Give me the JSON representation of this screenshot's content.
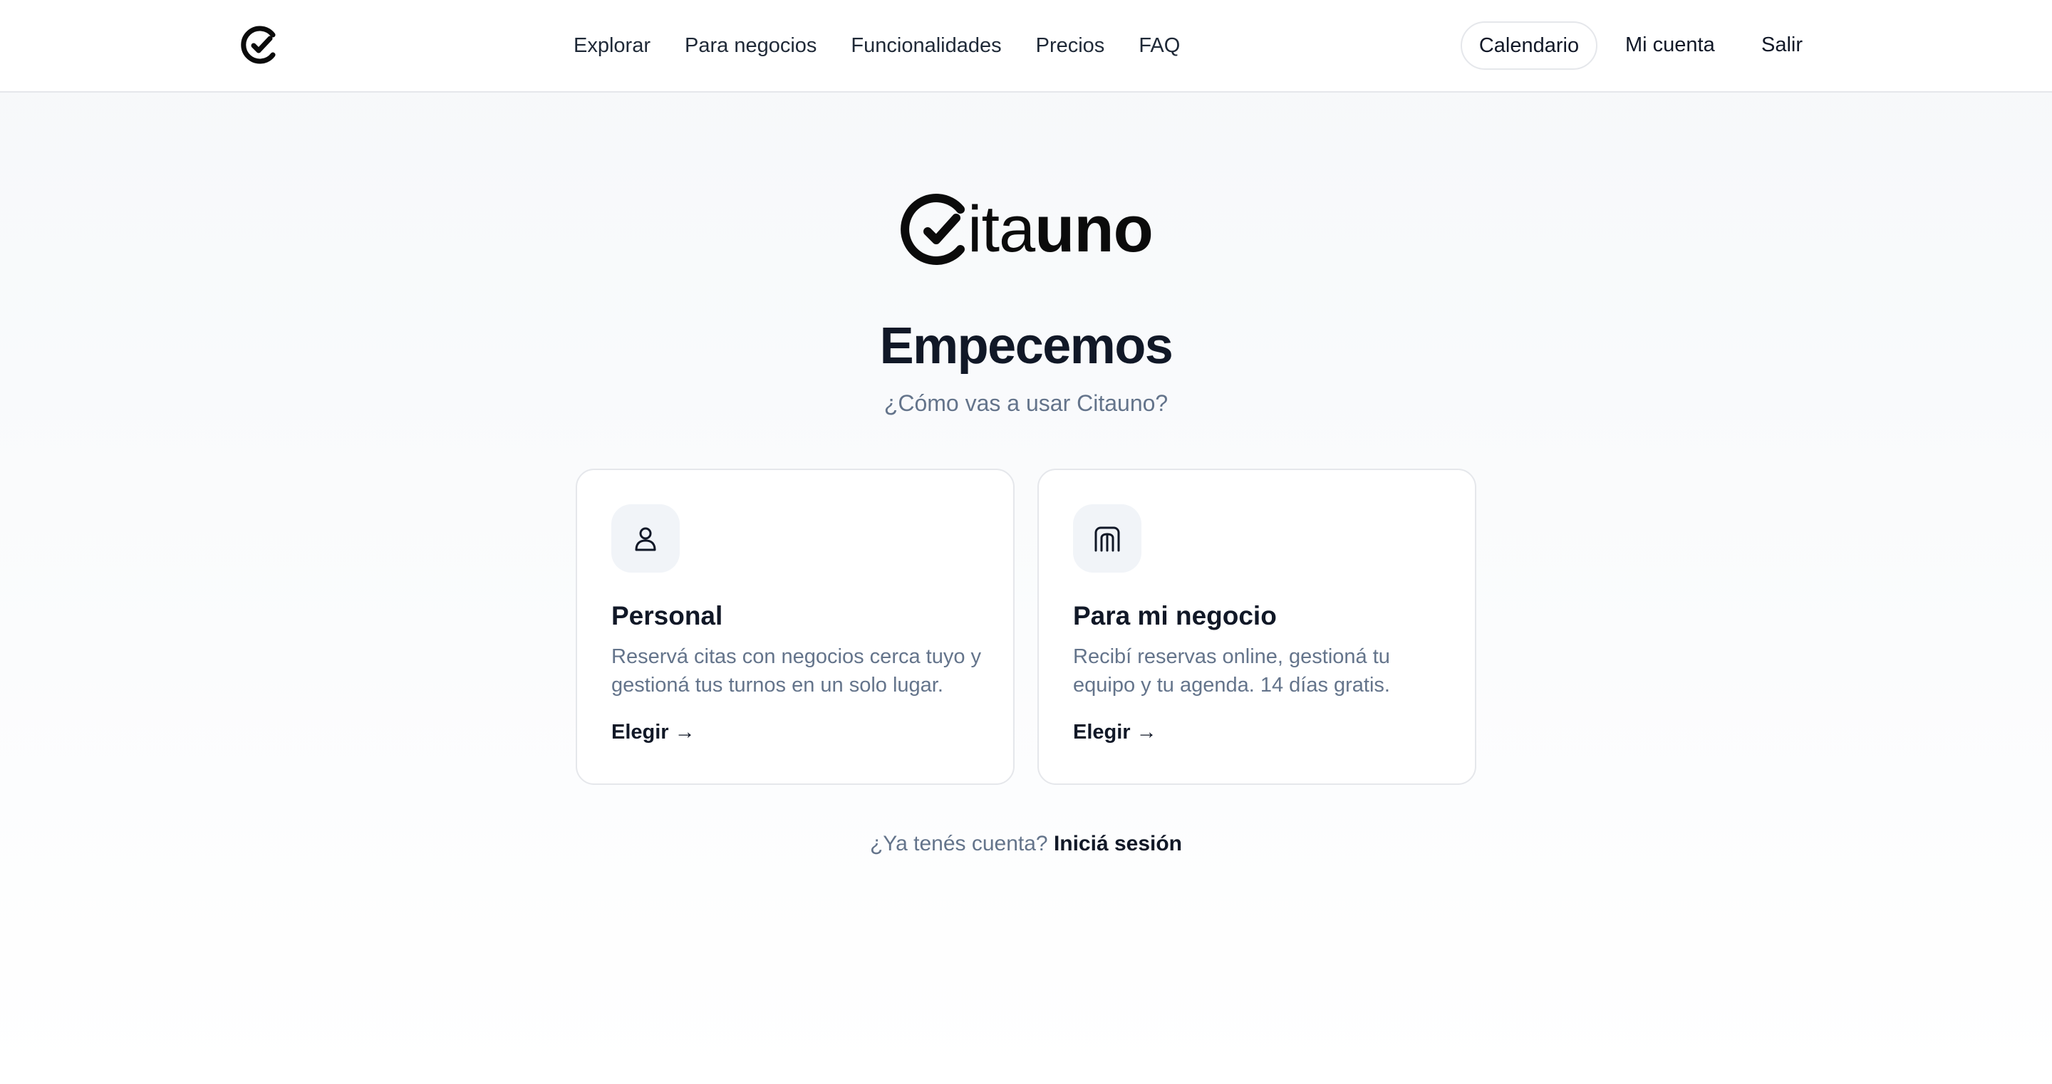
{
  "nav": {
    "logo_icon": "citauno-check-icon",
    "links": [
      "Explorar",
      "Para negocios",
      "Funcionalidades",
      "Precios",
      "FAQ"
    ],
    "calendar_button": "Calendario",
    "account": "Mi cuenta",
    "exit": "Salir"
  },
  "brand": {
    "name_light": "ita",
    "name_bold": "uno",
    "mark_icon": "citauno-logo-c-check-icon"
  },
  "heading": {
    "title": "Empecemos",
    "subtitle": "¿Cómo vas a usar Citauno?"
  },
  "cards": [
    {
      "icon": "user-icon",
      "title": "Personal",
      "description": "Reservá citas con negocios cerca tuyo y gestioná tus turnos en un solo lugar.",
      "cta": "Elegir →"
    },
    {
      "icon": "building-icon",
      "title": "Para mi negocio",
      "description": "Recibí reservas online, gestioná tu equipo y tu agenda. 14 días gratis.",
      "cta": "Elegir →"
    }
  ],
  "footer": {
    "question": "¿Ya tenés cuenta?",
    "login_link": "Iniciá sesión"
  },
  "colors": {
    "text_primary": "#111827",
    "text_muted": "#64748b",
    "border": "#e5e7eb",
    "icon_bg": "#f1f4f8"
  }
}
